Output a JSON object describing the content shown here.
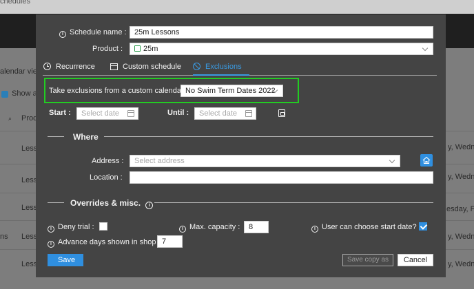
{
  "background": {
    "crumb": "chedules",
    "calendar_view": "alendar view",
    "show_label": "Show a",
    "col_header": "Prod",
    "rows": [
      {
        "name": "Less",
        "days": "y, Wedne"
      },
      {
        "name": "Less",
        "days": "y, Wedne"
      },
      {
        "name": "Less",
        "days": "esday, Fri"
      },
      {
        "name": "Less",
        "days": "y, Wedne"
      },
      {
        "name": "Less",
        "days": "y, Wedne"
      },
      {
        "name": "Less",
        "days": "y, Wedne"
      }
    ],
    "left_stub": "ns"
  },
  "modal": {
    "schedule_name_label": "Schedule name :",
    "schedule_name_value": "25m Lessons",
    "product_label": "Product :",
    "product_value": "25m",
    "tabs": [
      {
        "label": "Recurrence",
        "icon": "clock-icon"
      },
      {
        "label": "Custom schedule",
        "icon": "calendar-icon"
      },
      {
        "label": "Exclusions",
        "icon": "ban-icon",
        "active": true
      }
    ],
    "exclusions": {
      "calendar_label": "Take exclusions from a custom calendar :",
      "calendar_value": "No Swim Term Dates 2022",
      "start_label": "Start :",
      "start_placeholder": "Select date",
      "until_label": "Until :",
      "until_placeholder": "Select date"
    },
    "where": {
      "title": "Where",
      "address_label": "Address :",
      "address_placeholder": "Select address",
      "location_label": "Location :",
      "location_value": ""
    },
    "overrides": {
      "title": "Overrides & misc.",
      "deny_trial_label": "Deny trial :",
      "deny_trial_checked": false,
      "max_capacity_label": "Max. capacity :",
      "max_capacity_value": "8",
      "user_start_label": "User can choose start date? :",
      "user_start_checked": true,
      "advance_days_label": "Advance days shown in shop :",
      "advance_days_value": "7"
    },
    "buttons": {
      "save": "Save",
      "save_copy": "Save copy as",
      "cancel": "Cancel"
    }
  },
  "colors": {
    "accent": "#2f8fe0",
    "highlight": "#22cc22",
    "modal_bg": "#444444"
  }
}
